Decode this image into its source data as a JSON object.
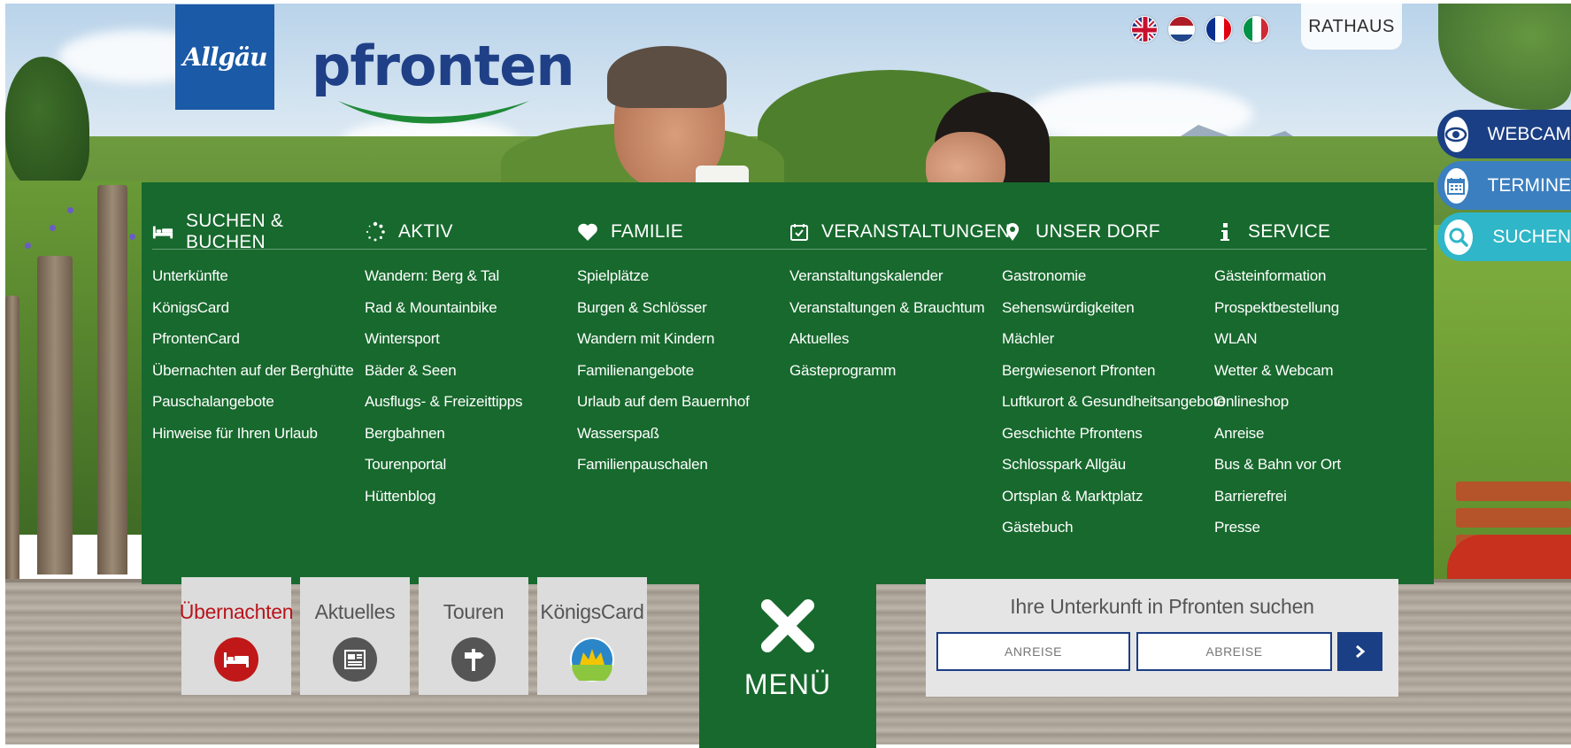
{
  "header": {
    "allgaeu_logo": "Allgäu",
    "pfronten_logo": "pfronten",
    "rathaus": "RATHAUS",
    "languages": [
      "english-flag",
      "dutch-flag",
      "french-flag",
      "italian-flag"
    ]
  },
  "side_tabs": [
    {
      "label": "WEBCAM",
      "icon": "eye-icon"
    },
    {
      "label": "TERMINE",
      "icon": "calendar-icon"
    },
    {
      "label": "SUCHEN",
      "icon": "search-icon"
    }
  ],
  "menu": {
    "columns": [
      {
        "heading": "SUCHEN & BUCHEN",
        "icon": "bed-icon",
        "items": [
          "Unterkünfte",
          "KönigsCard",
          "PfrontenCard",
          "Übernachten auf der Berghütte",
          "Pauschalangebote",
          "Hinweise für Ihren Urlaub"
        ]
      },
      {
        "heading": "AKTIV",
        "icon": "dots-circle-icon",
        "items": [
          "Wandern: Berg & Tal",
          "Rad & Mountainbike",
          "Wintersport",
          "Bäder & Seen",
          "Ausflugs- & Freizeittipps",
          "Bergbahnen",
          "Tourenportal",
          "Hüttenblog"
        ]
      },
      {
        "heading": "FAMILIE",
        "icon": "heart-icon",
        "items": [
          "Spielplätze",
          "Burgen & Schlösser",
          "Wandern mit Kindern",
          "Familienangebote",
          "Urlaub auf dem Bauernhof",
          "Wasserspaß",
          "Familienpauschalen"
        ]
      },
      {
        "heading": "VERANSTALTUNGEN",
        "icon": "calendar-check-icon",
        "items": [
          "Veranstaltungskalender",
          "Veranstaltungen & Brauchtum",
          "Aktuelles",
          "Gästeprogramm"
        ]
      },
      {
        "heading": "UNSER DORF",
        "icon": "map-pin-icon",
        "items": [
          "Gastronomie",
          "Sehenswürdigkeiten",
          "Mächler",
          "Bergwiesenort Pfronten",
          "Luftkurort & Gesundheitsangebote",
          "Geschichte Pfrontens",
          "Schlosspark Allgäu",
          "Ortsplan & Marktplatz",
          "Gästebuch"
        ]
      },
      {
        "heading": "SERVICE",
        "icon": "info-icon",
        "items": [
          "Gästeinformation",
          "Prospektbestellung",
          "WLAN",
          "Wetter & Webcam",
          "Onlineshop",
          "Anreise",
          "Bus & Bahn vor Ort",
          "Barrierefrei",
          "Presse"
        ]
      }
    ]
  },
  "tiles": [
    {
      "label": "Übernachten",
      "icon": "bed-icon",
      "color": "#c01818"
    },
    {
      "label": "Aktuelles",
      "icon": "newspaper-icon",
      "color": "#555555"
    },
    {
      "label": "Touren",
      "icon": "signpost-icon",
      "color": "#555555"
    },
    {
      "label": "KönigsCard",
      "icon": "koenigscard-icon",
      "color": "#555555"
    }
  ],
  "menu_button": {
    "label": "MENÜ"
  },
  "search": {
    "title": "Ihre Unterkunft in Pfronten suchen",
    "arrival_placeholder": "ANREISE",
    "departure_placeholder": "ABREISE"
  },
  "colors": {
    "menu_green": "#17692d",
    "brand_blue": "#1b3f84",
    "termine_blue": "#3b7fc0",
    "suchen_teal": "#2fb6c8"
  }
}
